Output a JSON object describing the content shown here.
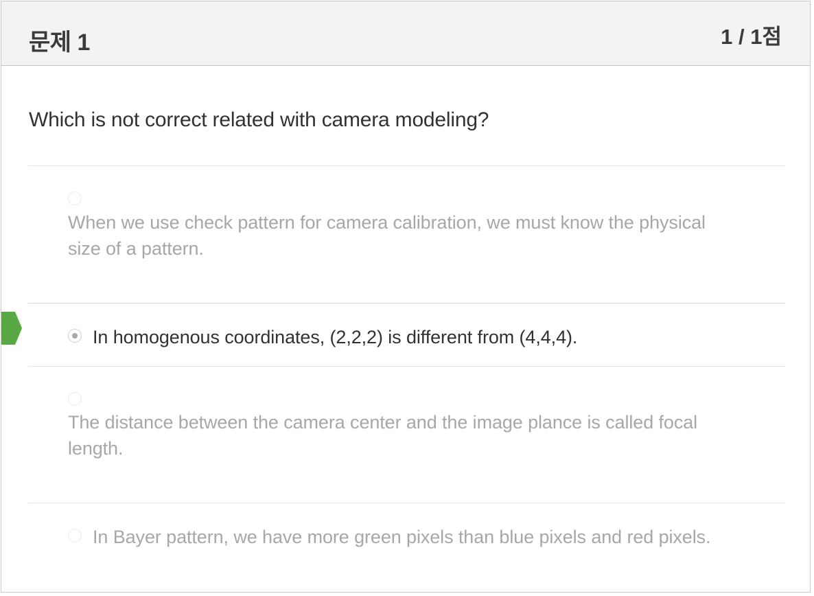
{
  "question": {
    "title": "문제 1",
    "score": "1 / 1점",
    "text": "Which is not correct related with camera modeling?"
  },
  "options": [
    {
      "line1": "When we use check pattern for camera calibration, we must know the physical",
      "line2": "size of a pattern.",
      "selected": false
    },
    {
      "line1": "In homogenous coordinates, (2,2,2) is different from (4,4,4).",
      "selected": true
    },
    {
      "line1": "The distance between the camera center and the image plance is called focal",
      "line2": "length.",
      "selected": false
    },
    {
      "line1": "In Bayer pattern, we have more green pixels than blue pixels and red pixels.",
      "selected": false
    }
  ],
  "colors": {
    "correct_marker": "#5aa845",
    "header_bg": "#f3f3f3",
    "muted_text": "#a5a7aa",
    "active_text": "#2f3135"
  },
  "icons": {
    "correct_marker": "correct-answer-marker-icon",
    "radio": "radio-button-icon"
  }
}
